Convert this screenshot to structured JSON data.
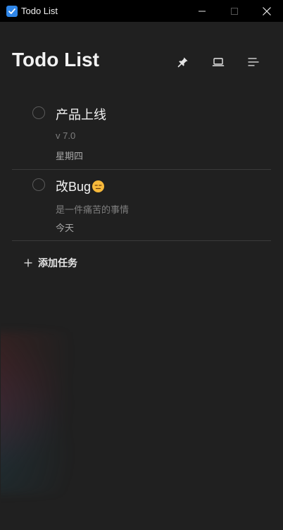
{
  "window": {
    "title": "Todo List",
    "accent": "#2f86e8"
  },
  "header": {
    "title": "Todo List",
    "tools": [
      {
        "icon": "pin-icon"
      },
      {
        "icon": "laptop-icon"
      },
      {
        "icon": "sort-lines-icon"
      }
    ]
  },
  "tasks": [
    {
      "title": "产品上线",
      "subtitle": "v 7.0",
      "date": "星期四",
      "emoji": ""
    },
    {
      "title": "改Bug",
      "subtitle": "是一件痛苦的事情",
      "date": "今天",
      "emoji": "expressionless-face-icon"
    }
  ],
  "add_task": {
    "label": "添加任务",
    "icon": "plus-icon"
  }
}
